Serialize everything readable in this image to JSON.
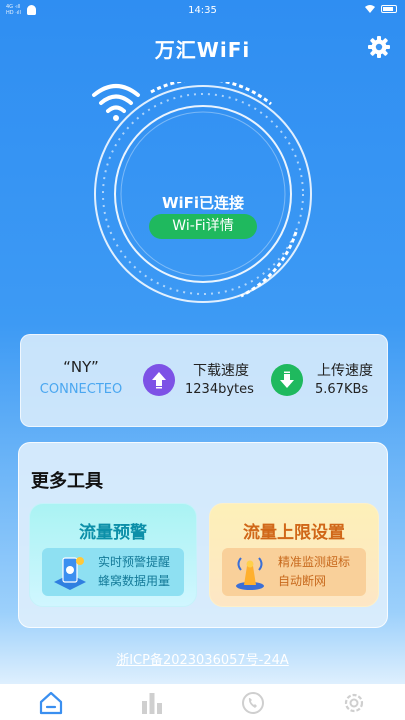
{
  "status_bar": {
    "time": "14:35",
    "signal_top": "4G  ·ıll",
    "signal_bottom": "HD  ·ıll"
  },
  "header": {
    "title": "万汇WiFi",
    "settings_icon": "gear-icon"
  },
  "connection": {
    "status": "WiFi已连接",
    "detail_button": "Wi-Fi详情",
    "icon": "wifi-icon"
  },
  "stats": {
    "ssid": "“NY”",
    "state": "CONNECTEO",
    "download_label": "下载速度",
    "download_value": "1234bytes",
    "upload_label": "上传速度",
    "upload_value": "5.67KBs"
  },
  "tools": {
    "title": "更多工具",
    "warning": {
      "title": "流量预警",
      "line1": "实时预警提醒",
      "line2": "蜂窝数据用量"
    },
    "limit": {
      "title": "流量上限设置",
      "line1": "精准监测超标",
      "line2": "自动断网"
    }
  },
  "icp": "浙ICP备2023036057号-24A",
  "nav": [
    {
      "icon": "home-icon",
      "active": true
    },
    {
      "icon": "bar-chart-icon",
      "active": false
    },
    {
      "icon": "phone-icon",
      "active": false
    },
    {
      "icon": "gear-icon",
      "active": false
    }
  ],
  "colors": {
    "accent": "#2f8ef2",
    "green": "#1fb95e",
    "purple": "#7d52e6"
  }
}
